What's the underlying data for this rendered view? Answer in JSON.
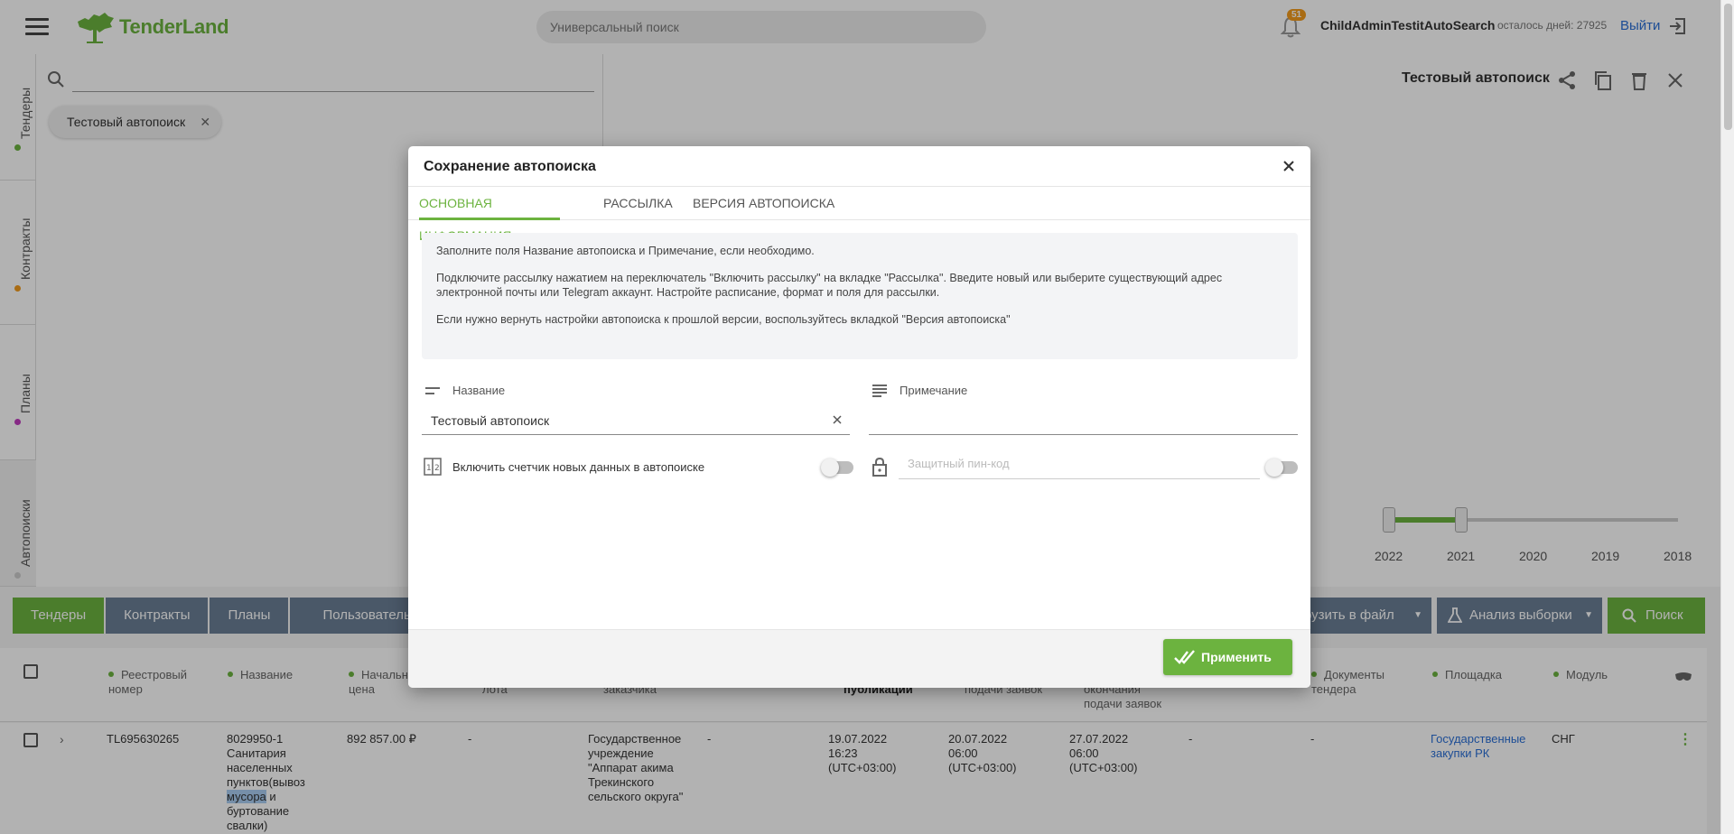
{
  "header": {
    "logo_text": "TenderLand",
    "search_placeholder": "Универсальный поиск",
    "notifications_count": "51",
    "username": "ChildAdminTestitAutoSearch",
    "days_left": "осталось дней: 27925",
    "logout_label": "Выйти"
  },
  "rail": {
    "items": [
      {
        "label": "Тендеры",
        "dot_color": "#6cb33f"
      },
      {
        "label": "Контракты",
        "dot_color": "#f29b1d"
      },
      {
        "label": "Планы",
        "dot_color": "#c03cbf"
      },
      {
        "label": "Автопоиски",
        "dot_color": "#cccccc"
      }
    ]
  },
  "filter": {
    "chip_label": "Тестовый автопоиск"
  },
  "autosearch": {
    "title": "Тестовый автопоиск",
    "years": [
      "2022",
      "2021",
      "2020",
      "2019",
      "2018"
    ]
  },
  "toolbar": {
    "tabs": [
      "Тендеры",
      "Контракты",
      "Планы",
      "Пользовательск"
    ],
    "export_label": "рузить в файл",
    "analysis_label": "Анализ выборки",
    "search_label": "Поиск"
  },
  "table": {
    "headers": [
      "Реестровый номер",
      "Название",
      "Начальн цена",
      "лота",
      "заказчика",
      "публикации",
      "подачи заявок",
      "окончания подачи заявок",
      "Документы тендера",
      "Площадка",
      "Модуль"
    ],
    "row": {
      "reg_number": "TL695630265",
      "name_line1": "8029950-1",
      "name_line2": "Санитария",
      "name_line3": "населенных",
      "name_line4": "пунктов(вывоз",
      "name_highlight": "мусора",
      "name_line5_rest": " и",
      "name_line6": "буртование",
      "name_line7": "свалки)",
      "price": "892 857.00 ₽",
      "lot": "-",
      "customer_l1": "Государственное",
      "customer_l2": "учреждение",
      "customer_l3": "\"Аппарат акима",
      "customer_l4": "Трекинского",
      "customer_l5": "сельского округа\"",
      "region": "-",
      "pub_date": "19.07.2022",
      "pub_time": "16:23",
      "pub_tz": "(UTC+03:00)",
      "start_date": "20.07.2022",
      "start_time": "06:00",
      "start_tz": "(UTC+03:00)",
      "end_date": "27.07.2022",
      "end_time": "06:00",
      "end_tz": "(UTC+03:00)",
      "col_a": "-",
      "col_b": "-",
      "platform_l1": "Государственные",
      "platform_l2": "закупки РК",
      "module": "СНГ"
    }
  },
  "modal": {
    "title": "Сохранение автопоиска",
    "tabs": [
      "Основная информация",
      "Рассылка",
      "Версия автопоиска"
    ],
    "info_p1": "Заполните поля Название автопоиска и Примечание, если необходимо.",
    "info_p2": "Подключите рассылку нажатием на переключатель \"Включить рассылку\" на вкладке \"Рассылка\". Введите новый или выберите существующий адрес электронной почты или Telegram аккаунт. Настройте расписание, формат и поля для рассылки.",
    "info_p3": "Если нужно вернуть настройки автопоиска к прошлой версии, воспользуйтесь вкладкой \"Версия автопоиска\"",
    "name_label": "Название",
    "name_value": "Тестовый автопоиск",
    "note_label": "Примечание",
    "note_value": "",
    "counter_label": "Включить счетчик новых данных в автопоиске",
    "counter_on": false,
    "pin_placeholder": "Защитный пин-код",
    "pin_on": false,
    "apply_label": "Применить"
  },
  "colors": {
    "accent": "#6cb33f",
    "link": "#2a6fd6",
    "toolbar_gray": "#6b7f95"
  }
}
